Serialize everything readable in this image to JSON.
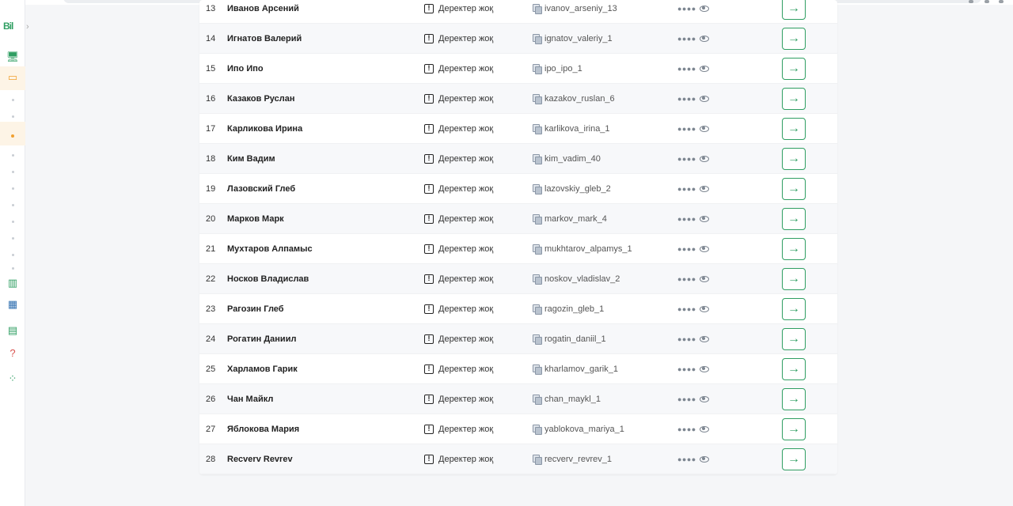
{
  "app": {
    "logo_text": "Bil"
  },
  "colors": {
    "accent": "#2f9e62",
    "sidebar_active": "#f0a030"
  },
  "sidebar": {
    "icons": [
      {
        "name": "monitor-icon",
        "glyph": "🖥"
      },
      {
        "name": "classroom-icon",
        "glyph": "▭"
      },
      {
        "name": "chart-icon",
        "glyph": "▥"
      },
      {
        "name": "table-icon",
        "glyph": "▦"
      },
      {
        "name": "card-icon",
        "glyph": "▤"
      },
      {
        "name": "help-icon",
        "glyph": "?"
      },
      {
        "name": "apps-icon",
        "glyph": "⁘"
      }
    ]
  },
  "table": {
    "director_label": "Деректер жоқ",
    "password_mask": "●●●●",
    "go_glyph": "→",
    "rows": [
      {
        "num": "13",
        "name": "Иванов Арсений",
        "login": "ivanov_arseniy_13"
      },
      {
        "num": "14",
        "name": "Игнатов Валерий",
        "login": "ignatov_valeriy_1"
      },
      {
        "num": "15",
        "name": "Ипо Ипо",
        "login": "ipo_ipo_1"
      },
      {
        "num": "16",
        "name": "Казаков Руслан",
        "login": "kazakov_ruslan_6"
      },
      {
        "num": "17",
        "name": "Карликова Ирина",
        "login": "karlikova_irina_1"
      },
      {
        "num": "18",
        "name": "Ким Вадим",
        "login": "kim_vadim_40"
      },
      {
        "num": "19",
        "name": "Лазовский Глеб",
        "login": "lazovskiy_gleb_2"
      },
      {
        "num": "20",
        "name": "Марков Марк",
        "login": "markov_mark_4"
      },
      {
        "num": "21",
        "name": "Мухтаров Алпамыс",
        "login": "mukhtarov_alpamys_1"
      },
      {
        "num": "22",
        "name": "Носков Владислав",
        "login": "noskov_vladislav_2"
      },
      {
        "num": "23",
        "name": "Рагозин Глеб",
        "login": "ragozin_gleb_1"
      },
      {
        "num": "24",
        "name": "Рогатин Даниил",
        "login": "rogatin_daniil_1"
      },
      {
        "num": "25",
        "name": "Харламов Гарик",
        "login": "kharlamov_garik_1"
      },
      {
        "num": "26",
        "name": "Чан Майкл",
        "login": "chan_maykl_1"
      },
      {
        "num": "27",
        "name": "Яблокова Мария",
        "login": "yablokova_mariya_1"
      },
      {
        "num": "28",
        "name": "Recverv Revrev",
        "login": "recverv_revrev_1"
      }
    ]
  }
}
